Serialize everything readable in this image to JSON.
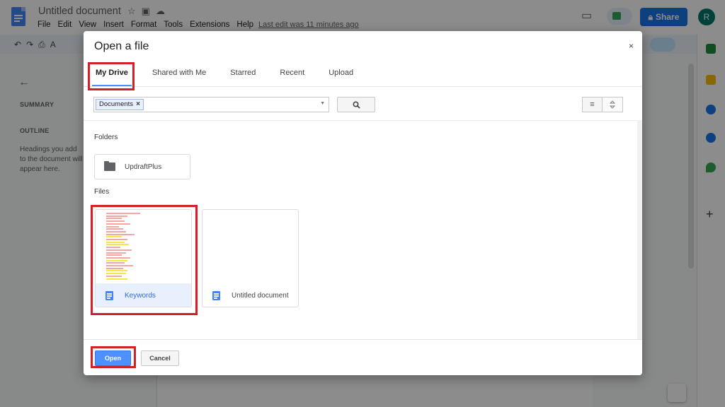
{
  "app": {
    "doc_title": "Untitled document",
    "menu": [
      "File",
      "Edit",
      "View",
      "Insert",
      "Format",
      "Tools",
      "Extensions",
      "Help"
    ],
    "last_edit": "Last edit was 11 minutes ago",
    "share_label": "Share",
    "avatar_letter": "R",
    "side_panel": {
      "summary_label": "SUMMARY",
      "outline_label": "OUTLINE",
      "outline_placeholder": "Headings you add to the document will appear here."
    }
  },
  "dialog": {
    "title": "Open a file",
    "close_glyph": "×",
    "tabs": [
      {
        "label": "My Drive",
        "active": true
      },
      {
        "label": "Shared with Me",
        "active": false
      },
      {
        "label": "Starred",
        "active": false
      },
      {
        "label": "Recent",
        "active": false
      },
      {
        "label": "Upload",
        "active": false
      }
    ],
    "search": {
      "chip_label": "Documents",
      "chip_remove": "×"
    },
    "folders_label": "Folders",
    "folders": [
      {
        "name": "UpdraftPlus"
      }
    ],
    "files_label": "Files",
    "files": [
      {
        "name": "Keywords",
        "selected": true
      },
      {
        "name": "Untitled document",
        "selected": false
      }
    ],
    "buttons": {
      "open_label": "Open",
      "cancel_label": "Cancel"
    }
  },
  "colors": {
    "highlight": "#d32028",
    "primary_button": "#4d90fe",
    "share_button": "#1a73e8",
    "selected_file": "#e8f0fe"
  }
}
